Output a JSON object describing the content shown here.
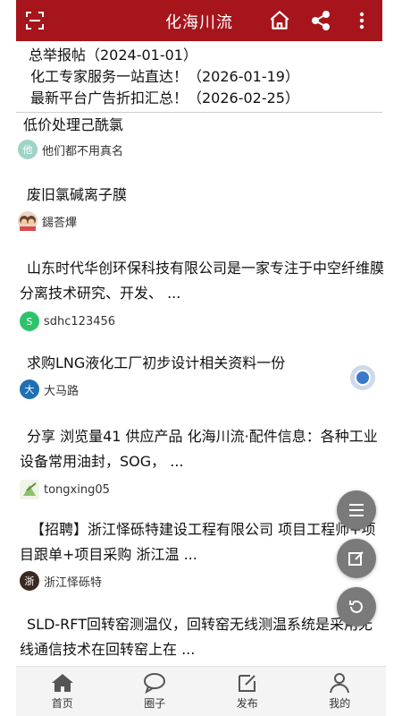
{
  "header": {
    "title": "化海川流",
    "scan_icon": "scan-icon",
    "home_icon": "home-icon",
    "share_icon": "share-icon",
    "more_icon": "more-vertical-icon",
    "color": "#a6151c"
  },
  "notices": [
    "总举报帖（2024-01-01）",
    "化工专家服务一站直达！（2026-01-19）",
    "最新平台广告折扣汇总！（2026-02-25）"
  ],
  "posts": [
    {
      "title": "低价处理己酰氯",
      "author": "他们都不用真名",
      "avatar_text": "他",
      "avatar_color": "#9fd3c7"
    },
    {
      "title": "废旧氯碱离子膜",
      "author": "鐋荅熚",
      "avatar_text": "",
      "avatar_color": "#c9a48a"
    },
    {
      "title": "山东时代华创环保科技有限公司是一家专注于中空纤维膜分离技术研究、开发、 ...",
      "author": "sdhc123456",
      "avatar_text": "S",
      "avatar_color": "#2cc36b"
    },
    {
      "title": "求购LNG液化工厂初步设计相关资料一份",
      "author": "大马路",
      "avatar_text": "大",
      "avatar_color": "#1f6fb2"
    },
    {
      "title": "分享 浏览量41 供应产品 化海川流·配件信息：各种工业设备常用油封，SOG， ...",
      "author": "tongxing05",
      "avatar_text": "",
      "avatar_color": "#8fbf6a"
    },
    {
      "title": "【招聘】浙江怿砾特建设工程有限公司 项目工程师+项目跟单+项目采购 浙江温 ...",
      "author": "浙江怿砾特",
      "avatar_text": "浙",
      "avatar_color": "#3b2a22"
    },
    {
      "title": "SLD-RFT回转窑测温仪，回转窑无线测温系统是采用无线通信技术在回转窑上在 ...",
      "author": "",
      "avatar_text": "",
      "avatar_color": "#cccccc"
    }
  ],
  "fabs": {
    "menu_icon": "menu-icon",
    "edit_icon": "edit-icon",
    "refresh_icon": "refresh-icon"
  },
  "bottom_nav": [
    {
      "label": "首页",
      "icon": "home-filled-icon"
    },
    {
      "label": "圈子",
      "icon": "chat-bubble-icon"
    },
    {
      "label": "发布",
      "icon": "compose-icon"
    },
    {
      "label": "我的",
      "icon": "user-icon"
    }
  ]
}
